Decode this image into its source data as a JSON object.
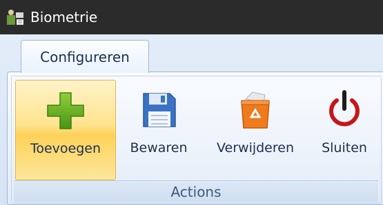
{
  "window": {
    "title": "Biometrie"
  },
  "ribbon": {
    "tabs": [
      {
        "label": "Configureren",
        "active": true
      }
    ],
    "group": {
      "name": "Actions",
      "buttons": [
        {
          "label": "Toevoegen",
          "icon": "add-icon",
          "active": true
        },
        {
          "label": "Bewaren",
          "icon": "save-icon",
          "active": false
        },
        {
          "label": "Verwijderen",
          "icon": "recycle-bin-icon",
          "active": false
        },
        {
          "label": "Sluiten",
          "icon": "power-icon",
          "active": false
        }
      ]
    }
  },
  "colors": {
    "titlebar": "#2b2b2b",
    "ribbon_bg": "#dfe9f5",
    "active_button": "#fdd25a",
    "add_green": "#5aa61c",
    "save_blue": "#3a73c4",
    "delete_orange": "#f07a1c",
    "power_red": "#c5171b"
  }
}
